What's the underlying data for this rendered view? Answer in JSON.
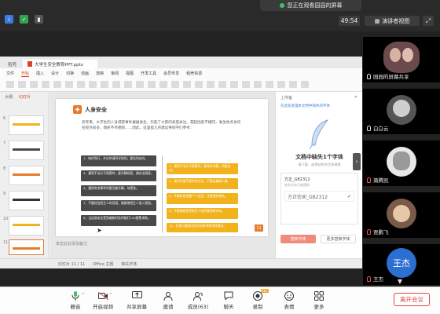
{
  "meeting": {
    "share_banner": "您正在观看园园的屏幕",
    "timer": "49:54",
    "view_label": "演讲者视图",
    "fullscreen_icon": "fullscreen-icon"
  },
  "app": {
    "tabs": [
      "稻壳",
      "大学生安全教育PPT.pptx"
    ],
    "menu": [
      "文件",
      "开始",
      "插入",
      "设计",
      "切换",
      "动画",
      "放映",
      "审阅",
      "视图",
      "开发工具",
      "会员专享",
      "稻壳资源"
    ],
    "thumb_tabs": [
      "大纲",
      "幻灯片"
    ],
    "thumb_numbers": [
      "6",
      "7",
      "8",
      "9",
      "10",
      "11"
    ],
    "notes_placeholder": "单击此处添加备注",
    "status": [
      "幻灯片 11 / 11",
      "Office 主题",
      "缺失字体"
    ]
  },
  "slide": {
    "title": "人身安全",
    "intro": "近年来，大学生的人身侵害事件屡屡发生，引起了大家的高度关注。其起因各不相同，发生地点也均在校外较多，情形不尽相同……因此，这里提几点建议供同学们参考：",
    "left_cards": [
      "1、结伴而行，外出时请同学陪同，要告知去向。",
      "3、遇到不法分子侵害时，要冷静机智，想办法脱身。",
      "5、遇到突发事件时要沉着冷静，勿慌张。",
      "7、不要轻信陌生人的话语，随意带陌生人进入宿舍。",
      "9、当自身安全受到威胁时及时拨打110报警求助。"
    ],
    "right_cards": [
      "2、遇到不法分子侵害时，要保持冷静，机智应对。",
      "4、夜间尽量不要单独外出，不要走偏僻小路。",
      "6、不要轻易泄露个人信息，注意保护隐私。",
      "8、不要随意接受陌生人给的食物和饮料。",
      "10、发现可疑情况及时向老师和学校报告。"
    ],
    "page_number": "11"
  },
  "font_panel": {
    "header": "上传备",
    "notice": "在此处处理本文档中缺失的字体",
    "title": "文档中缺失1个字体",
    "subtitle": "请下载，或将缺失的字体替换",
    "font_name": "方正_GB2312",
    "font_desc": "缺失字体已被替换",
    "preview_text": "方正仿宋_GB2312",
    "buttons": [
      "替换字体",
      "更多替换字体"
    ]
  },
  "participants": [
    {
      "name": "园园的屏幕共享",
      "mic": "on"
    },
    {
      "name": "白白云",
      "mic": "on"
    },
    {
      "name": "萧腾凯",
      "mic": "off"
    },
    {
      "name": "贾鹏飞",
      "mic": "off"
    },
    {
      "name": "王杰",
      "mic": "off",
      "avatar_text": "王杰"
    }
  ],
  "toolbar": {
    "items": [
      {
        "label": "静音",
        "icon": "microphone-icon"
      },
      {
        "label": "开启视频",
        "icon": "camera-off-icon"
      },
      {
        "label": "共享屏幕",
        "icon": "share-screen-icon"
      },
      {
        "label": "邀请",
        "icon": "invite-icon"
      },
      {
        "label": "成员(63)",
        "icon": "members-icon"
      },
      {
        "label": "聊天",
        "icon": "chat-icon"
      },
      {
        "label": "录制",
        "icon": "record-icon",
        "badge": "REC"
      },
      {
        "label": "表情",
        "icon": "emoji-icon"
      },
      {
        "label": "更多",
        "icon": "more-icon"
      }
    ],
    "leave_label": "离开会议"
  },
  "colors": {
    "accent_orange": "#e67a2f",
    "card_dark": "#4a4a4a",
    "card_yellow": "#f2b21c",
    "leave_red": "#e04747",
    "avatar_blue": "#2d6fd0"
  }
}
